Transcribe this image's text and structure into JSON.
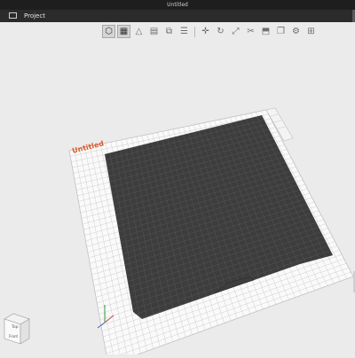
{
  "window": {
    "title": "Untitled"
  },
  "menu": {
    "items": [
      "Project"
    ]
  },
  "toolbar": {
    "buttons": [
      {
        "name": "iso-view-button",
        "glyph": "⬡",
        "active": true
      },
      {
        "name": "grid-view-button",
        "glyph": "▦",
        "active": true
      },
      {
        "name": "perspective-button",
        "glyph": "△",
        "active": false
      },
      {
        "name": "layers-button",
        "glyph": "▤",
        "active": false
      },
      {
        "name": "arrange-button",
        "glyph": "⧉",
        "active": false
      },
      {
        "name": "stack-button",
        "glyph": "☰",
        "active": false
      },
      {
        "name": "add-button",
        "glyph": "✛",
        "active": false
      },
      {
        "name": "rotate-button",
        "glyph": "↻",
        "active": false
      },
      {
        "name": "scale-button",
        "glyph": "⤢",
        "active": false
      },
      {
        "name": "cut-button",
        "glyph": "✂",
        "active": false
      },
      {
        "name": "place-on-face-button",
        "glyph": "⬒",
        "active": false
      },
      {
        "name": "duplicate-button",
        "glyph": "❐",
        "active": false
      },
      {
        "name": "settings-button",
        "glyph": "⚙",
        "active": false
      },
      {
        "name": "support-button",
        "glyph": "⊞",
        "active": false
      }
    ]
  },
  "scene": {
    "bed_label": "Untitled",
    "colors": {
      "background": "#ebebeb",
      "grid_frame": "#fafafa",
      "grid_line": "#bdbdbd",
      "bed_surface": "#3d3d3d",
      "bed_line": "#5a5a5a",
      "label_color": "#e05a2b"
    }
  },
  "view_cube": {
    "top_label": "Top",
    "front_label": "Front"
  }
}
